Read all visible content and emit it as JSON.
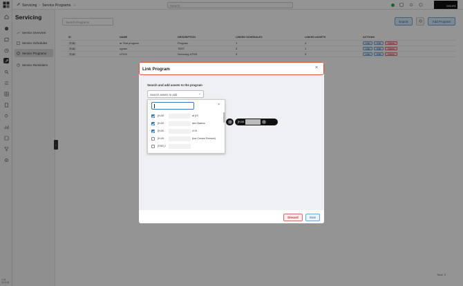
{
  "header": {
    "breadcrumb": [
      "Servicing",
      "Service Programs"
    ],
    "search_placeholder": "Search",
    "user_box": "INSURE"
  },
  "rail": {
    "version": [
      "1.41",
      "12.0.24"
    ]
  },
  "sidebar": {
    "title": "Servicing",
    "items": [
      {
        "label": "Service Overview",
        "icon": "trend-icon",
        "active": false
      },
      {
        "label": "Service Schedules",
        "icon": "calendar-icon",
        "active": false
      },
      {
        "label": "Service Programs",
        "icon": "gauge-icon",
        "active": true
      },
      {
        "label": "Service Reminders",
        "icon": "clock-icon",
        "active": false
      }
    ]
  },
  "main": {
    "search_placeholder": "Search Programs",
    "export_label": "Export",
    "add_label": "Add Program",
    "columns": [
      "ID",
      "NAME",
      "DESCRIPTION",
      "LINKED SCHEDULES",
      "LINKED ASSETS",
      "ACTIONS"
    ],
    "rows": [
      {
        "id": "P-18",
        "name": "ar Test program",
        "description": "Program",
        "schedules": "1",
        "assets": "4"
      },
      {
        "id": "P-18",
        "name": "ogram",
        "description": "TEST",
        "schedules": "3",
        "assets": "1"
      },
      {
        "id": "P-18",
        "name": "UTDS",
        "description": "Servicing UTDS",
        "schedules": "3",
        "assets": "3"
      }
    ],
    "actions": {
      "link": "Link",
      "edit": "Edit",
      "delete": "Delete"
    },
    "total": "Total: 3"
  },
  "modal": {
    "title": "Link Program",
    "section_label": "Search and add assets to the program",
    "select_placeholder": "Search assets to add",
    "options": [
      {
        "code": "[H-00",
        "name": "al (IS",
        "checked": true
      },
      {
        "code": "[H-00",
        "name": "den Barma",
        "checked": true
      },
      {
        "code": "[H-00",
        "name": "r2 B",
        "checked": true
      },
      {
        "code": "[H-00",
        "name": "(Ice Cream Freezer)",
        "checked": false
      },
      {
        "code": "[SSE] I",
        "name": "",
        "checked": false
      }
    ],
    "chips": [
      {
        "code": "[H-00"
      },
      {
        "code": "[H-00"
      }
    ],
    "discard_label": "Discard",
    "save_label": "Save"
  },
  "colors": {
    "accent": "#2f78c4",
    "danger": "#d46a6a",
    "modal_border": "#e0502c"
  }
}
